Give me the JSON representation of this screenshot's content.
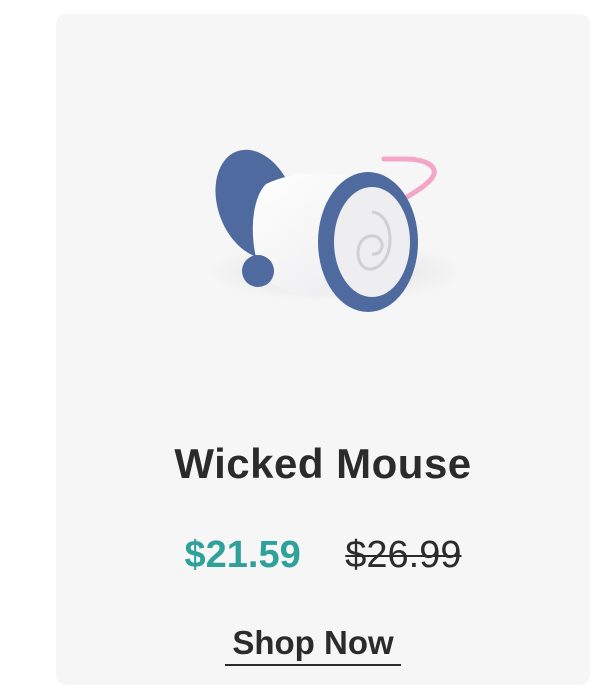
{
  "product": {
    "name": "Wicked Mouse",
    "image_icon": "robotic-mouse-toy",
    "price_sale": "$21.59",
    "price_original": "$26.99",
    "cta_label": "Shop Now"
  },
  "colors": {
    "card_bg": "#f6f6f6",
    "sale_price": "#2fa19b",
    "text": "#2b2b2b",
    "toy_blue": "#4e6a9e",
    "toy_tail": "#f4a6c8"
  }
}
